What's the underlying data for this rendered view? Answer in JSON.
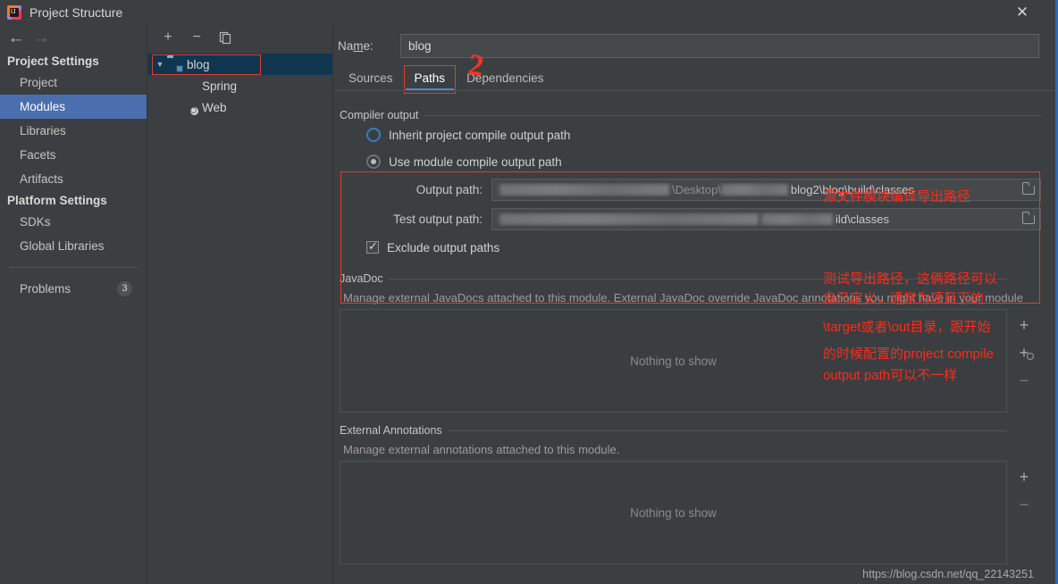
{
  "window": {
    "title": "Project Structure",
    "app_icon": "intellij-idea-icon",
    "close_label": "✕",
    "accent_border": "#2d6ab0"
  },
  "sidebar": {
    "nav": {
      "back": "←",
      "forward": "→"
    },
    "groups": [
      {
        "title": "Project Settings",
        "items": [
          {
            "label": "Project",
            "selected": false
          },
          {
            "label": "Modules",
            "selected": true
          },
          {
            "label": "Libraries",
            "selected": false
          },
          {
            "label": "Facets",
            "selected": false
          },
          {
            "label": "Artifacts",
            "selected": false
          }
        ]
      },
      {
        "title": "Platform Settings",
        "items": [
          {
            "label": "SDKs",
            "selected": false
          },
          {
            "label": "Global Libraries",
            "selected": false
          }
        ]
      }
    ],
    "problems": {
      "label": "Problems",
      "count": "3"
    }
  },
  "tree": {
    "toolbar": {
      "add": "+",
      "remove": "−",
      "copy": "copy-icon"
    },
    "nodes": [
      {
        "label": "blog",
        "icon": "module-folder-icon",
        "level": 0,
        "expanded": true,
        "selected": true,
        "annotated": true
      },
      {
        "label": "Spring",
        "icon": "spring-leaf-icon",
        "level": 1,
        "expanded": false,
        "selected": false,
        "annotated": false
      },
      {
        "label": "Web",
        "icon": "web-globe-icon",
        "level": 1,
        "expanded": false,
        "selected": false,
        "annotated": false
      }
    ]
  },
  "main": {
    "name_label": "Name:",
    "name_value": "blog",
    "tabs": [
      {
        "label": "Sources",
        "active": false,
        "annotated": false
      },
      {
        "label": "Paths",
        "active": true,
        "annotated": true
      },
      {
        "label": "Dependencies",
        "active": false,
        "annotated": false
      }
    ],
    "compiler_output": {
      "group_title": "Compiler output",
      "inherit_label": "Inherit project compile output path",
      "inherit_selected": false,
      "module_label": "Use module compile output path",
      "module_selected": true,
      "output_path_label": "Output path:",
      "output_path_value": "…\\Desktop\\…blog2\\blog\\build\\classes",
      "output_path_visible_tail": "blog2\\blog\\build\\classes",
      "output_path_visible_mid": "\\Desktop\\",
      "test_output_path_label": "Test output path:",
      "test_output_path_value": "…\\build\\classes",
      "test_output_path_visible_tail": "ild\\classes",
      "exclude_label": "Exclude output paths",
      "exclude_checked": true,
      "browse_icon": "folder-browse-icon"
    },
    "javadoc": {
      "group_title": "JavaDoc",
      "description": "Manage external JavaDocs attached to this module. External JavaDoc override JavaDoc annotations you might have in your module",
      "empty_text": "Nothing to show",
      "buttons": [
        {
          "name": "add",
          "label": "+"
        },
        {
          "name": "add-url",
          "label": "+"
        },
        {
          "name": "remove",
          "label": "−"
        }
      ]
    },
    "external_annotations": {
      "group_title": "External Annotations",
      "description": "Manage external annotations attached to this module.",
      "empty_text": "Nothing to show",
      "buttons": [
        {
          "name": "add",
          "label": "+"
        },
        {
          "name": "remove",
          "label": "−"
        }
      ]
    }
  },
  "annotations": {
    "marker_2": "2",
    "note_output_path": "源文件模块编译导出路径",
    "note_test_path_line1": "测试导出路径，这俩路径可以",
    "note_test_path_line2": "自己定义，通常为项目下的",
    "note_test_path_line3": "\\target或者\\out目录，跟开始",
    "note_test_path_line4": "的时候配置的project compile",
    "note_test_path_line5": "output path可以不一样",
    "color": "#fb2b1c"
  },
  "watermark": "https://blog.csdn.net/qq_22143251"
}
